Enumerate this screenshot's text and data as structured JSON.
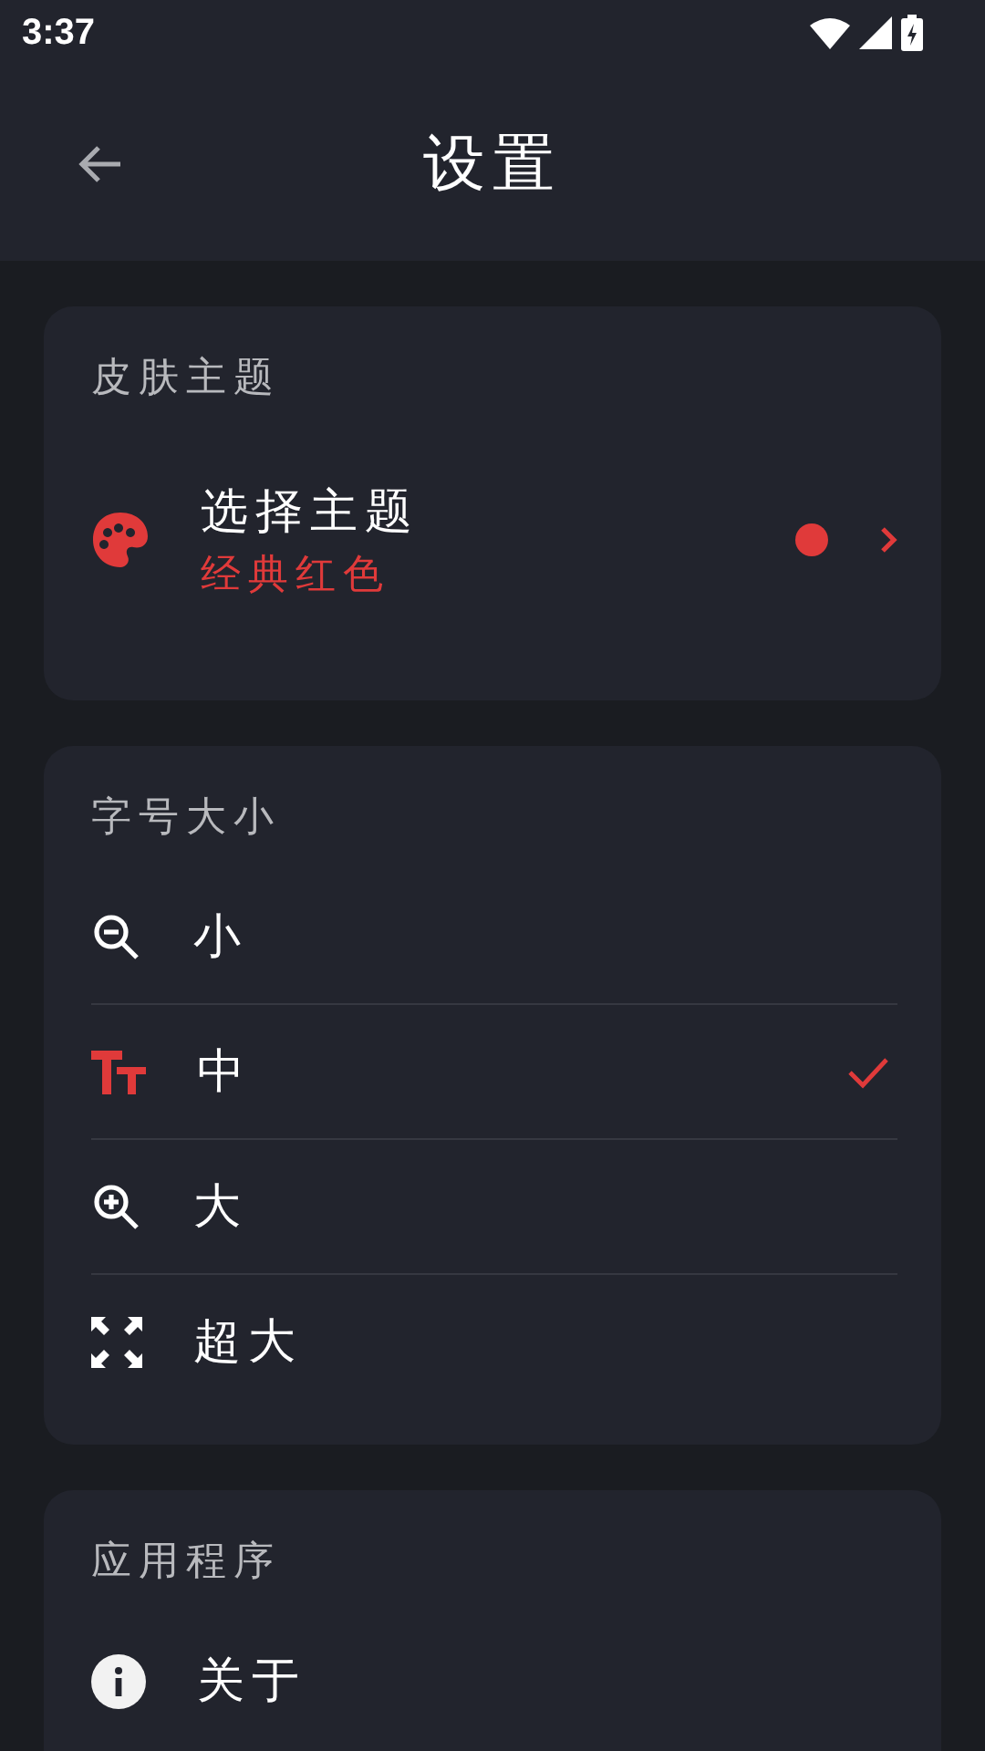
{
  "status_bar": {
    "time": "3:37"
  },
  "header": {
    "title": "设置"
  },
  "sections": [
    {
      "title": "皮肤主题",
      "kind": "theme",
      "items": [
        {
          "label": "选择主题",
          "value": "经典红色",
          "color": "#e03a3a"
        }
      ]
    },
    {
      "title": "字号大小",
      "kind": "choices",
      "items": [
        {
          "label": "小",
          "kind": "zoom-out",
          "selected": false
        },
        {
          "label": "中",
          "kind": "text-size",
          "selected": true
        },
        {
          "label": "大",
          "kind": "zoom-in",
          "selected": false
        },
        {
          "label": "超大",
          "kind": "expand",
          "selected": false
        }
      ]
    },
    {
      "title": "应用程序",
      "kind": "links",
      "items": [
        {
          "label": "关于",
          "kind": "info"
        }
      ]
    }
  ]
}
